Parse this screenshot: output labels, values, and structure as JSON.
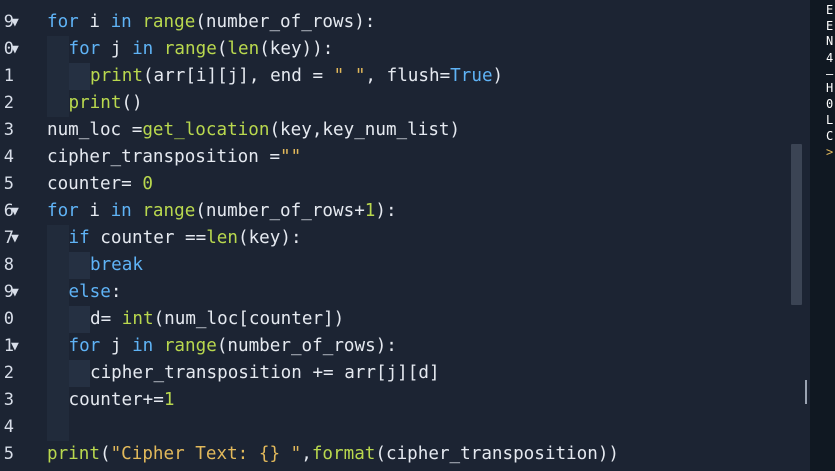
{
  "editor": {
    "gutter": [
      {
        "num": "9",
        "fold": true
      },
      {
        "num": "0",
        "fold": true
      },
      {
        "num": "1",
        "fold": false
      },
      {
        "num": "2",
        "fold": false
      },
      {
        "num": "3",
        "fold": false
      },
      {
        "num": "4",
        "fold": false
      },
      {
        "num": "5",
        "fold": false
      },
      {
        "num": "6",
        "fold": true
      },
      {
        "num": "7",
        "fold": true
      },
      {
        "num": "8",
        "fold": false
      },
      {
        "num": "9",
        "fold": true
      },
      {
        "num": "0",
        "fold": false
      },
      {
        "num": "1",
        "fold": true
      },
      {
        "num": "2",
        "fold": false
      },
      {
        "num": "3",
        "fold": false
      },
      {
        "num": "4",
        "fold": false
      },
      {
        "num": "5",
        "fold": false
      }
    ],
    "fold_glyph": "▼",
    "lines": [
      {
        "indent": 0,
        "tokens": [
          [
            "kw",
            "for"
          ],
          [
            "op",
            " i "
          ],
          [
            "kw",
            "in"
          ],
          [
            "op",
            " "
          ],
          [
            "fn",
            "range"
          ],
          [
            "op",
            "(number_of_rows):"
          ]
        ]
      },
      {
        "indent": 1,
        "tokens": [
          [
            "kw",
            "for"
          ],
          [
            "op",
            " j "
          ],
          [
            "kw",
            "in"
          ],
          [
            "op",
            " "
          ],
          [
            "fn",
            "range"
          ],
          [
            "op",
            "("
          ],
          [
            "fn",
            "len"
          ],
          [
            "op",
            "(key)):"
          ]
        ]
      },
      {
        "indent": 2,
        "tokens": [
          [
            "fn",
            "print"
          ],
          [
            "op",
            "(arr[i][j], end = "
          ],
          [
            "str",
            "\" \""
          ],
          [
            "op",
            ", flush="
          ],
          [
            "tr",
            "True"
          ],
          [
            "op",
            ")"
          ]
        ]
      },
      {
        "indent": 1,
        "tokens": [
          [
            "fn",
            "print"
          ],
          [
            "op",
            "()"
          ]
        ]
      },
      {
        "indent": 0,
        "tokens": [
          [
            "op",
            "num_loc ="
          ],
          [
            "fn",
            "get_location"
          ],
          [
            "op",
            "(key,key_num_list)"
          ]
        ]
      },
      {
        "indent": 0,
        "tokens": [
          [
            "op",
            "cipher_transposition ="
          ],
          [
            "str",
            "\"\""
          ]
        ]
      },
      {
        "indent": 0,
        "tokens": [
          [
            "op",
            "counter= "
          ],
          [
            "num",
            "0"
          ]
        ]
      },
      {
        "indent": 0,
        "tokens": [
          [
            "kw",
            "for"
          ],
          [
            "op",
            " i "
          ],
          [
            "kw",
            "in"
          ],
          [
            "op",
            " "
          ],
          [
            "fn",
            "range"
          ],
          [
            "op",
            "(number_of_rows+"
          ],
          [
            "num",
            "1"
          ],
          [
            "op",
            "):"
          ]
        ]
      },
      {
        "indent": 1,
        "tokens": [
          [
            "kw",
            "if"
          ],
          [
            "op",
            " counter =="
          ],
          [
            "fn",
            "len"
          ],
          [
            "op",
            "(key):"
          ]
        ]
      },
      {
        "indent": 2,
        "tokens": [
          [
            "kw",
            "break"
          ]
        ]
      },
      {
        "indent": 1,
        "tokens": [
          [
            "kw",
            "else"
          ],
          [
            "op",
            ":"
          ]
        ]
      },
      {
        "indent": 2,
        "tokens": [
          [
            "op",
            "d= "
          ],
          [
            "fn",
            "int"
          ],
          [
            "op",
            "(num_loc[counter])"
          ]
        ]
      },
      {
        "indent": 1,
        "tokens": [
          [
            "kw",
            "for"
          ],
          [
            "op",
            " j "
          ],
          [
            "kw",
            "in"
          ],
          [
            "op",
            " "
          ],
          [
            "fn",
            "range"
          ],
          [
            "op",
            "(number_of_rows):"
          ]
        ]
      },
      {
        "indent": 2,
        "tokens": [
          [
            "op",
            "cipher_transposition += arr[j][d]"
          ]
        ]
      },
      {
        "indent": 1,
        "tokens": [
          [
            "op",
            "counter+="
          ],
          [
            "num",
            "1"
          ]
        ]
      },
      {
        "indent": 1,
        "tokens": []
      },
      {
        "indent": 0,
        "tokens": [
          [
            "fn",
            "print"
          ],
          [
            "op",
            "("
          ],
          [
            "str",
            "\"Cipher Text: {} \""
          ],
          [
            "op",
            ","
          ],
          [
            "fn",
            "format"
          ],
          [
            "op",
            "(cipher_transposition))"
          ]
        ]
      }
    ]
  },
  "console": {
    "lines": [
      "E",
      "E",
      "N",
      "4",
      "—",
      "H",
      "0",
      "L",
      "C",
      ">"
    ]
  },
  "colors": {
    "background": "#1c2433",
    "keyword": "#5fb3f6",
    "function": "#b9d84e",
    "string": "#e2b95b",
    "text": "#e5e9f0"
  }
}
